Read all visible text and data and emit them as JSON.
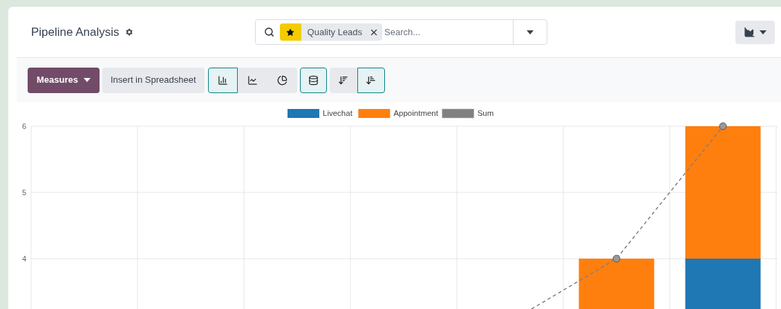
{
  "header": {
    "title": "Pipeline Analysis"
  },
  "search": {
    "facets": [
      {
        "label": "Quality Leads"
      }
    ],
    "placeholder": "Search..."
  },
  "toolbar": {
    "measures": "Measures",
    "insert": "Insert in Spreadsheet",
    "chart_types": [
      {
        "kind": "bar",
        "selected": true
      },
      {
        "kind": "line",
        "selected": false
      },
      {
        "kind": "pie",
        "selected": false
      }
    ],
    "stacked": {
      "selected": true
    },
    "sort": [
      {
        "kind": "descending",
        "selected": false
      },
      {
        "kind": "ascending",
        "selected": true
      }
    ]
  },
  "chart": {
    "legend": [
      {
        "label": "Livechat",
        "kind": "bar",
        "color": "#1f77b4"
      },
      {
        "label": "Appointment",
        "kind": "bar",
        "color": "#ff7f0e"
      },
      {
        "label": "Sum",
        "kind": "line",
        "color": "#808080"
      }
    ],
    "y_ticks": [
      "6",
      "5",
      "4"
    ]
  }
}
